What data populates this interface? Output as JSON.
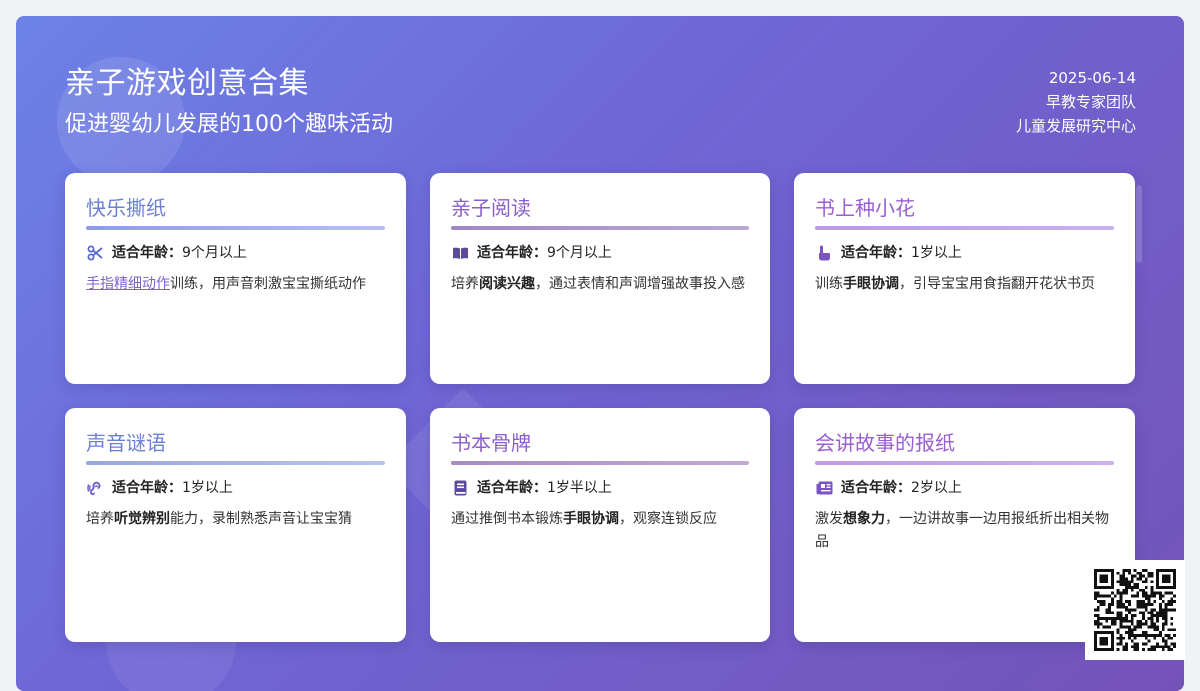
{
  "header": {
    "title": "亲子游戏创意合集",
    "subtitle": "促进婴幼儿发展的100个趣味活动",
    "date": "2025-06-14",
    "team": "早教专家团队",
    "org": "儿童发展研究中心"
  },
  "age_label": "适合年龄：",
  "colors": {
    "gradient_start": "#6c82e6",
    "gradient_end": "#7453b8",
    "title_blue": "#6b6fd1",
    "title_purple": "#8a5fc9",
    "link": "#7e63c8"
  },
  "cards": [
    {
      "title": "快乐撕纸",
      "icon": "scissors-icon",
      "age": "9个月以上",
      "desc_pre": "",
      "desc_link": "手指精细动作",
      "desc_bold": "",
      "desc_post": "训练，用声音刺激宝宝撕纸动作"
    },
    {
      "title": "亲子阅读",
      "icon": "open-book-icon",
      "age": "9个月以上",
      "desc_pre": "培养",
      "desc_link": "",
      "desc_bold": "阅读兴趣",
      "desc_post": "，通过表情和声调增强故事投入感"
    },
    {
      "title": "书上种小花",
      "icon": "pointing-hand-icon",
      "age": "1岁以上",
      "desc_pre": "训练",
      "desc_link": "",
      "desc_bold": "手眼协调",
      "desc_post": "，引导宝宝用食指翻开花状书页"
    },
    {
      "title": "声音谜语",
      "icon": "ear-sound-icon",
      "age": "1岁以上",
      "desc_pre": "培养",
      "desc_link": "",
      "desc_bold": "听觉辨别",
      "desc_post": "能力，录制熟悉声音让宝宝猜"
    },
    {
      "title": "书本骨牌",
      "icon": "book-icon",
      "age": "1岁半以上",
      "desc_pre": "通过推倒书本锻炼",
      "desc_link": "",
      "desc_bold": "手眼协调",
      "desc_post": "，观察连锁反应"
    },
    {
      "title": "会讲故事的报纸",
      "icon": "newspaper-icon",
      "age": "2岁以上",
      "desc_pre": "激发",
      "desc_link": "",
      "desc_bold": "想象力",
      "desc_post": "，一边讲故事一边用报纸折出相关物品"
    }
  ],
  "qr_icon": "qr-code-icon"
}
